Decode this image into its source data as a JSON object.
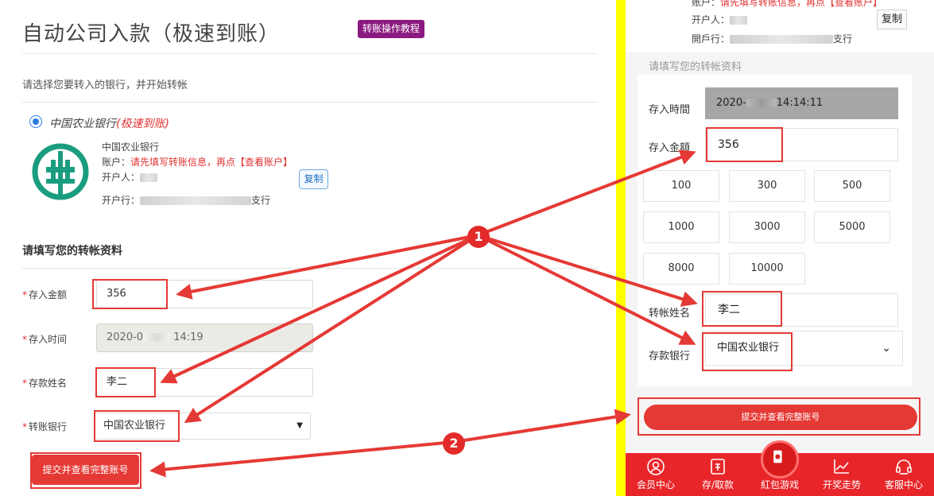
{
  "left": {
    "title": "自动公司入款（极速到账）",
    "tutorial_label": "转账操作教程",
    "choose_text": "请选择您要转入的银行，并开始转帐",
    "bank_option": {
      "name": "中国农业银行",
      "tag": "(极速到账)"
    },
    "bank_info": {
      "bank_name": "中国农业银行",
      "account_label": "账户：",
      "account_hint": "请先填写转账信息，再点【查看账户】",
      "holder_label": "开户人：",
      "branch_label": "开户行：",
      "branch_suffix": "支行",
      "copy_label": "复制"
    },
    "section_title": "请填写您的转帐资料",
    "form": {
      "star": "*",
      "amount_label": "存入金额",
      "amount_value": "356",
      "time_label": "存入时间",
      "time_value": "2020-0",
      "time_suffix": "14:19",
      "name_label": "存款姓名",
      "name_value": "李二",
      "bank_label": "转账银行",
      "bank_value": "中国农业银行",
      "submit_label": "提交并查看完整账号"
    }
  },
  "right": {
    "top": {
      "account_label": "账户：",
      "account_hint": "请先填写转账信息，再点【查看账户】",
      "holder_label": "开户人：",
      "branch_label": "開戶行：",
      "branch_suffix": "支行",
      "copy_label": "复制"
    },
    "section_title": "请填写您的转帐资料",
    "form": {
      "time_label": "存入時間",
      "time_value": "2020-",
      "time_suffix": "14:14:11",
      "amount_label": "存入金額",
      "amount_value": "356",
      "amounts": [
        "100",
        "300",
        "500",
        "1000",
        "3000",
        "5000",
        "8000",
        "10000"
      ],
      "name_label": "转帐姓名",
      "name_value": "李二",
      "bank_label": "存款银行",
      "bank_value": "中国农业银行",
      "submit_label": "提交并查看完整账号"
    },
    "tabs": [
      "会员中心",
      "存/取款",
      "紅包游戏",
      "开奖走势",
      "客服中心"
    ]
  },
  "annotations": {
    "badge_1": "1",
    "badge_2": "2"
  },
  "colors": {
    "accent_red": "#e53935",
    "divider_yellow": "#ffff00",
    "tutorial_purple": "#8b1a80",
    "abc_green": "#1a9d7f"
  }
}
